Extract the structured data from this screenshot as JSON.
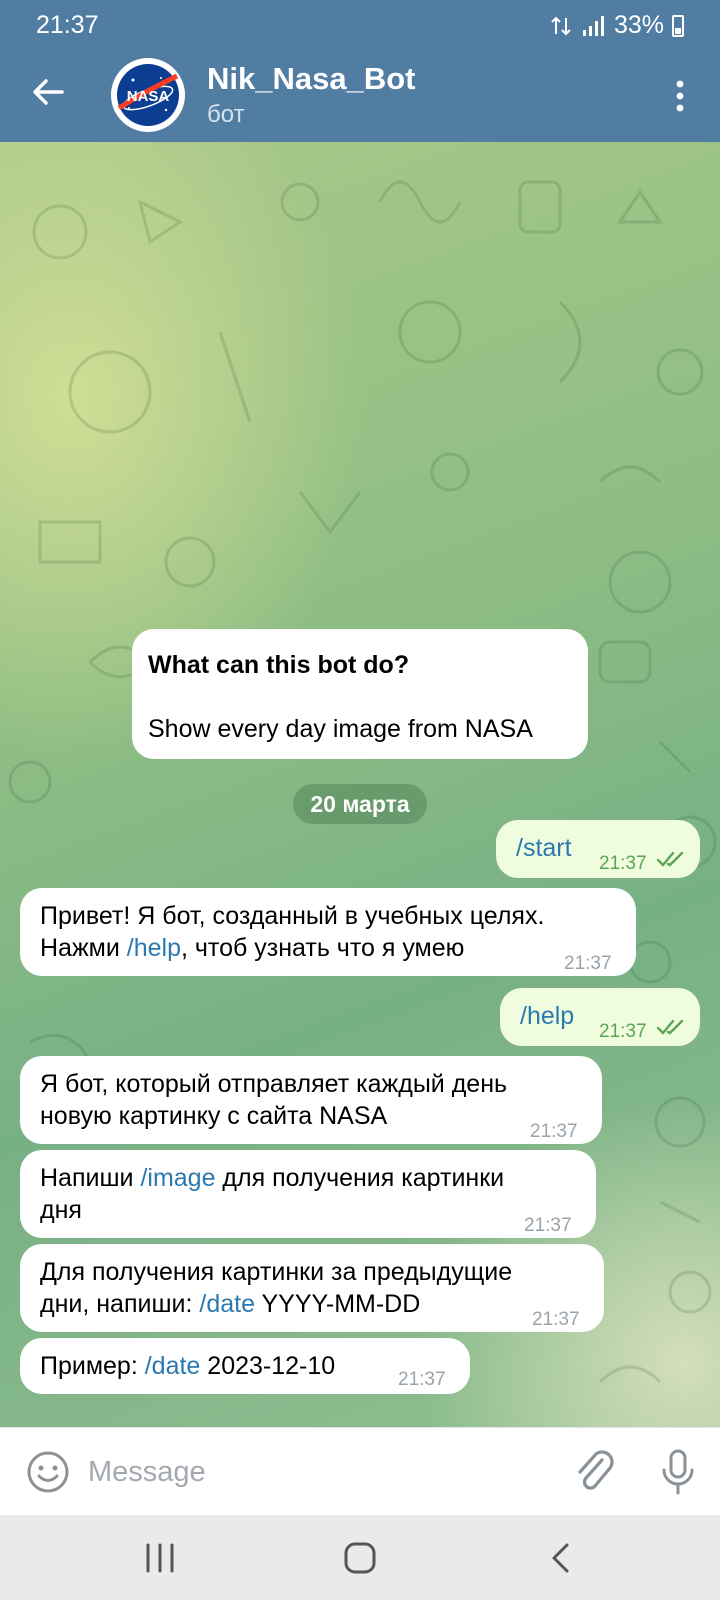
{
  "status_bar": {
    "time": "21:37",
    "battery": "33%"
  },
  "header": {
    "title": "Nik_Nasa_Bot",
    "subtitle": "бот",
    "avatar_label": "NASA"
  },
  "info_card": {
    "title": "What can this bot do?",
    "text": "Show every day image from NASA"
  },
  "date_separator": "20 марта",
  "messages": [
    {
      "direction": "outgoing",
      "segments": [
        {
          "text": "/start",
          "link": true
        }
      ],
      "time": "21:37",
      "read": true
    },
    {
      "direction": "incoming",
      "segments": [
        {
          "text": "Привет! Я бот, созданный в учебных целях."
        },
        {
          "text": "Нажми "
        },
        {
          "text": "/help",
          "link": true
        },
        {
          "text": ", чтоб узнать что я умею"
        }
      ],
      "time": "21:37"
    },
    {
      "direction": "outgoing",
      "segments": [
        {
          "text": "/help",
          "link": true
        }
      ],
      "time": "21:37",
      "read": true
    },
    {
      "direction": "incoming",
      "segments": [
        {
          "text": "Я бот, который отправляет каждый день"
        },
        {
          "text": "новую картинку с сайта NASA"
        }
      ],
      "time": "21:37"
    },
    {
      "direction": "incoming",
      "segments": [
        {
          "text": "Напиши "
        },
        {
          "text": "/image",
          "link": true
        },
        {
          "text": " для получения картинки"
        },
        {
          "text": "дня"
        }
      ],
      "time": "21:37"
    },
    {
      "direction": "incoming",
      "segments": [
        {
          "text": "Для получения картинки за предыдущие"
        },
        {
          "text": "дни, напиши: "
        },
        {
          "text": "/date",
          "link": true
        },
        {
          "text": " YYYY-MM-DD"
        }
      ],
      "time": "21:37"
    },
    {
      "direction": "incoming",
      "segments": [
        {
          "text": "Пример:  "
        },
        {
          "text": "/date",
          "link": true
        },
        {
          "text": " 2023-12-10"
        }
      ],
      "time": "21:37"
    }
  ],
  "input": {
    "placeholder": "Message",
    "value": ""
  },
  "colors": {
    "header": "#527da3",
    "link": "#2b79b0",
    "outgoing_bubble": "#effdde",
    "read_tick": "#5aa55a"
  }
}
